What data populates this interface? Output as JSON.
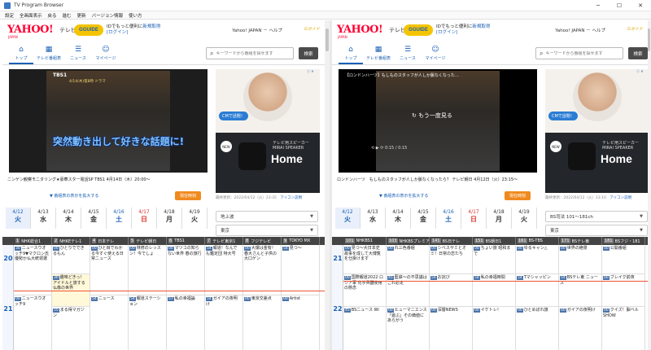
{
  "window": {
    "title": "TV Program Browser",
    "minimize_glyph": "─",
    "maximize_glyph": "☐",
    "close_glyph": "✕"
  },
  "menu": [
    "設定",
    "全画面表示",
    "戻る",
    "進む",
    "更新",
    "バージョン情報",
    "使い方"
  ],
  "panes": [
    {
      "header": {
        "logo": "YAHOO!",
        "logo_sub": "JAPAN",
        "tv": "テレビ",
        "gguide": "GGUIDE",
        "promo_line1_pre": "IDでもっと便利に",
        "promo_line1_link": "新規取得",
        "promo_line2": "[ログイン]",
        "yj_help": "Yahoo! JAPAN － ヘルプ",
        "corner_logo": "Gガイド"
      },
      "nav": [
        {
          "icon": "⌂",
          "label": "トップ"
        },
        {
          "icon": "▦",
          "label": "テレビ番組表"
        },
        {
          "icon": "☰",
          "label": "ニュース"
        },
        {
          "icon": "☺",
          "label": "マイページ"
        }
      ],
      "search": {
        "placeholder": "キーワードから番組を探せます",
        "button": "検索"
      },
      "video": {
        "channel": "TBS1",
        "top_caption": "4/14(木)夜8時 ドラマ",
        "big_caption": "突然動き出して好きな話題に!",
        "title": "",
        "reload": "",
        "time": ""
      },
      "ad": {
        "cm_label": "CMで話題！",
        "new": "NEW",
        "line1": "テレビ用スピーカー",
        "line2": "MIRAI SPEAKER",
        "home": "Home",
        "icons": "ⓘ ✕"
      },
      "caption": "ニンゲン観察モニタリング★豪華スター電話SP TBS1 4月14日（木）20:00〜",
      "expand": "▼ 番組表の表示を拡大する",
      "now_button": "現在時刻",
      "updated": "最終更新：2022/04/12（火）23:35",
      "icon_note": "アイコン説明",
      "dates": [
        {
          "md": "4/12",
          "wd": "火",
          "kind": "sel"
        },
        {
          "md": "4/13",
          "wd": "水",
          "kind": ""
        },
        {
          "md": "4/14",
          "wd": "木",
          "kind": ""
        },
        {
          "md": "4/15",
          "wd": "金",
          "kind": ""
        },
        {
          "md": "4/16",
          "wd": "土",
          "kind": "sat"
        },
        {
          "md": "4/17",
          "wd": "日",
          "kind": "sun"
        },
        {
          "md": "4/18",
          "wd": "月",
          "kind": ""
        },
        {
          "md": "4/19",
          "wd": "火",
          "kind": ""
        }
      ],
      "select1": "地上波",
      "select2": "東京",
      "channels": [
        "NHK総合1",
        "NHKEテレ1",
        "日本テレ",
        "テレビ朝日",
        "TBS1",
        "テレビ東京1",
        "フジテレビ",
        "TOKYO MX"
      ],
      "channel_nums": [
        "1",
        "2",
        "4",
        "5",
        "6",
        "7",
        "8",
        "9"
      ],
      "hours": [
        "20",
        "21"
      ],
      "programs": [
        [
          {
            "time": "30",
            "title": "ニュースウオッチ9▼マクロン氏優勢か仏大統領選",
            "hl": false
          },
          {
            "time": "00",
            "title": "ニュースウオッチ9",
            "hl": false
          }
        ],
        [
          {
            "time": "00",
            "title": "ひとりでできるもん",
            "hl": false
          },
          {
            "time": "30",
            "title": "趣味どきっ！アイドルと旅する仏像の世界",
            "hl": true
          },
          {
            "time": "55",
            "title": "まる得マガジン",
            "hl": false
          }
        ],
        [
          {
            "time": "00",
            "title": "ひと目でわかる今すぐ使える日常ニュース",
            "hl": false
          },
          {
            "time": "54",
            "title": "ニュース",
            "hl": false
          }
        ],
        [
          {
            "time": "00",
            "title": "林修のレッスン！今でしょ",
            "hl": false
          },
          {
            "time": "54",
            "title": "報道ステーション",
            "hl": false
          }
        ],
        [
          {
            "time": "00",
            "title": "マツコの知らない世界 春の旅行",
            "hl": false
          },
          {
            "time": "57",
            "title": "私の幸福論",
            "hl": false
          }
        ],
        [
          {
            "time": "54",
            "title": "報道！なんでも鑑定団 特大号",
            "hl": false
          },
          {
            "time": "54",
            "title": "ガイアの夜明け",
            "hl": false
          }
        ],
        [
          {
            "time": "00",
            "title": "大爆は金有！春大さんと子供の大口ゲン",
            "hl": false
          },
          {
            "time": "00",
            "title": "東京交差点",
            "hl": false
          }
        ],
        [
          {
            "time": "54",
            "title": "見つ～",
            "hl": false
          },
          {
            "time": "00",
            "title": "Artist",
            "hl": false
          }
        ]
      ]
    },
    {
      "header": {
        "logo": "YAHOO!",
        "logo_sub": "JAPAN",
        "tv": "テレビ",
        "gguide": "GGUIDE",
        "promo_line1_pre": "IDでもっと便利に",
        "promo_line1_link": "新規取得",
        "promo_line2": "[ログイン]",
        "yj_help": "Yahoo! JAPAN － ヘルプ",
        "corner_logo": "Gガイド"
      },
      "nav": [
        {
          "icon": "⌂",
          "label": "トップ"
        },
        {
          "icon": "▦",
          "label": "テレビ番組表"
        },
        {
          "icon": "☰",
          "label": "ニュース"
        },
        {
          "icon": "☺",
          "label": "マイページ"
        }
      ],
      "search": {
        "placeholder": "キーワードから番組を探せます",
        "button": "検索"
      },
      "video": {
        "channel": "",
        "top_caption": "",
        "big_caption": "",
        "title": "【ロンドンハーツ】もしものスタッフが人しか脈なくなった…",
        "reload": "↻ もう一度見る",
        "time": "⟲ ▶ ⟳   0:15 / 0:15"
      },
      "ad": {
        "cm_label": "CMで話題！",
        "new": "NEW",
        "line1": "テレビ用スピーカー",
        "line2": "MIRAI SPEAKER",
        "home": "Home",
        "icons": "ⓘ ✕"
      },
      "caption": "ロンドンハーツ　もしものスタッフが人しか脈なくなったら？ テレビ朝日 4月12日（火）23:15〜",
      "expand": "▼ 番組表の表示を拡大する",
      "now_button": "現在時刻",
      "updated": "最終更新：2022/04/12（火）23:10",
      "icon_note": "アイコン説明",
      "dates": [
        {
          "md": "4/12",
          "wd": "火",
          "kind": "sel"
        },
        {
          "md": "4/13",
          "wd": "水",
          "kind": ""
        },
        {
          "md": "4/14",
          "wd": "木",
          "kind": ""
        },
        {
          "md": "4/15",
          "wd": "金",
          "kind": ""
        },
        {
          "md": "4/16",
          "wd": "土",
          "kind": "sat"
        },
        {
          "md": "4/17",
          "wd": "日",
          "kind": "sun"
        },
        {
          "md": "4/18",
          "wd": "月",
          "kind": ""
        },
        {
          "md": "4/19",
          "wd": "火",
          "kind": ""
        }
      ],
      "select1": "BS司法 101〜181ch",
      "select2": "東京",
      "channels": [
        "NHKBS1",
        "NHKBSプレミア",
        "BS日テレ",
        "BS朝日1",
        "BS-TBS",
        "BSテレ東",
        "BSフジ・181"
      ],
      "channel_nums": [
        "101",
        "103",
        "141",
        "151",
        "161",
        "171",
        "181"
      ],
      "hours": [
        "21",
        "22"
      ],
      "programs": [
        [
          {
            "time": "00",
            "title": "見つ～大日本史 故事を成して大博覧を仕掛けます",
            "hl": false
          },
          {
            "time": "00",
            "title": "国際報道2022 ロシア軍 化学兵器使用の懸念",
            "hl": false
          },
          {
            "time": "45",
            "title": "BSニュース Wi",
            "hl": false
          }
        ],
        [
          {
            "time": "00",
            "title": "れ三色番組",
            "hl": false
          },
          {
            "time": "45",
            "title": "藍鉄〜の不思議はこれ必定",
            "hl": false
          },
          {
            "time": "00",
            "title": "ヒューマニエンス「遊ぶ」その価値にあらがう",
            "hl": false
          }
        ],
        [
          {
            "time": "00",
            "title": "シベスサミとオミ！日常の恋たち",
            "hl": false
          },
          {
            "time": "54",
            "title": "お詫び",
            "hl": false
          },
          {
            "time": "00",
            "title": "深層NEWS",
            "hl": false
          }
        ],
        [
          {
            "time": "00",
            "title": "ちょい旅 昭和まで",
            "hl": false
          },
          {
            "time": "54",
            "title": "私の幸福時間",
            "hl": false
          },
          {
            "time": "00",
            "title": "イケトレ！",
            "hl": false
          }
        ],
        [
          {
            "time": "00",
            "title": "ゆるキャン△",
            "hl": false
          },
          {
            "time": "54",
            "title": "Tマシャッピン",
            "hl": false
          },
          {
            "time": "00",
            "title": "ひとめぼれ旅",
            "hl": false
          }
        ],
        [
          {
            "time": "00",
            "title": "世界の絶景",
            "hl": false
          },
          {
            "time": "54",
            "title": "BSテレ東 ニュース",
            "hl": false
          },
          {
            "time": "00",
            "title": "ガイアの夜明け",
            "hl": false
          }
        ],
        [
          {
            "time": "00",
            "title": "公開番組",
            "hl": false
          },
          {
            "time": "00",
            "title": "ブレイク前夜",
            "hl": false
          },
          {
            "time": "00",
            "title": "クイズ！脳ベルSHOW",
            "hl": false
          }
        ]
      ]
    }
  ]
}
